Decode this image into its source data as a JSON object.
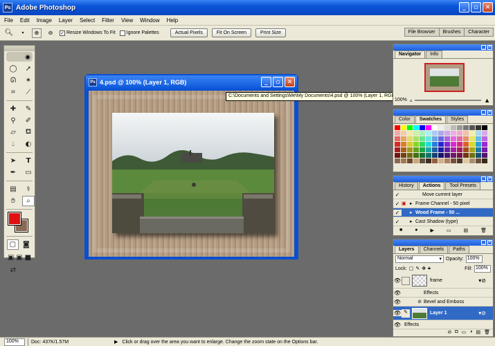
{
  "app": {
    "title": "Adobe Photoshop"
  },
  "menu": [
    "File",
    "Edit",
    "Image",
    "Layer",
    "Select",
    "Filter",
    "View",
    "Window",
    "Help"
  ],
  "options": {
    "resize_label": "Resize Windows To Fit",
    "ignore_label": "Ignore Palettes",
    "actual_pixels": "Actual Pixels",
    "fit_on_screen": "Fit On Screen",
    "print_size": "Print Size",
    "wells": [
      "File Browser",
      "Brushes",
      "Character"
    ]
  },
  "document": {
    "title": "4.psd @ 100% (Layer 1, RGB)",
    "tooltip": "C:\\Documents and Settings\\Me\\My Documents\\4.psd @ 100% (Layer 1, RGB)"
  },
  "navigator": {
    "tabs": [
      "Navigator",
      "Info"
    ],
    "zoom": "100%"
  },
  "color_palette": {
    "tabs": [
      "Color",
      "Swatches",
      "Styles"
    ]
  },
  "actions": {
    "tabs": [
      "History",
      "Actions",
      "Tool Presets"
    ],
    "items": [
      "Move current layer",
      "Frame Channel - 50 pixel",
      "Wood Frame - 50 ...",
      "Cast Shadow (type)"
    ]
  },
  "layers": {
    "tabs": [
      "Layers",
      "Channels",
      "Paths"
    ],
    "blend_mode": "Normal",
    "opacity_label": "Opacity:",
    "opacity": "100%",
    "lock_label": "Lock:",
    "fill_label": "Fill:",
    "fill": "100%",
    "items": [
      {
        "name": "frame"
      },
      {
        "name": "Effects"
      },
      {
        "name": "Bevel and Emboss"
      },
      {
        "name": "Layer 1"
      },
      {
        "name": "Effects"
      }
    ]
  },
  "status": {
    "zoom": "100%",
    "doc": "Doc: 437K/1.57M",
    "hint": "Click or drag over the area you want to enlarge. Change the zoom state on the Options bar."
  },
  "colors": {
    "foreground": "#e01010",
    "background": "#8a6a55",
    "titlebar": "#0a55d8"
  }
}
